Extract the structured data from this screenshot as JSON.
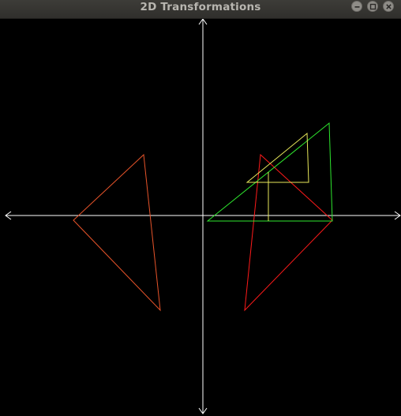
{
  "window": {
    "title": "2D Transformations",
    "buttons": {
      "minimize": "minimize",
      "maximize": "maximize",
      "close": "close"
    }
  },
  "colors": {
    "background": "#000000",
    "axes": "#ffffff",
    "shape_orange": "#e8542a",
    "shape_red": "#ff1a1a",
    "shape_green": "#2ee62e",
    "shape_yellow": "#e8e85a",
    "titlebar": "#353431",
    "title_text": "#b8b6b0"
  },
  "icons": {
    "minimize": "minimize-icon",
    "maximize": "maximize-icon",
    "close": "close-icon"
  }
}
